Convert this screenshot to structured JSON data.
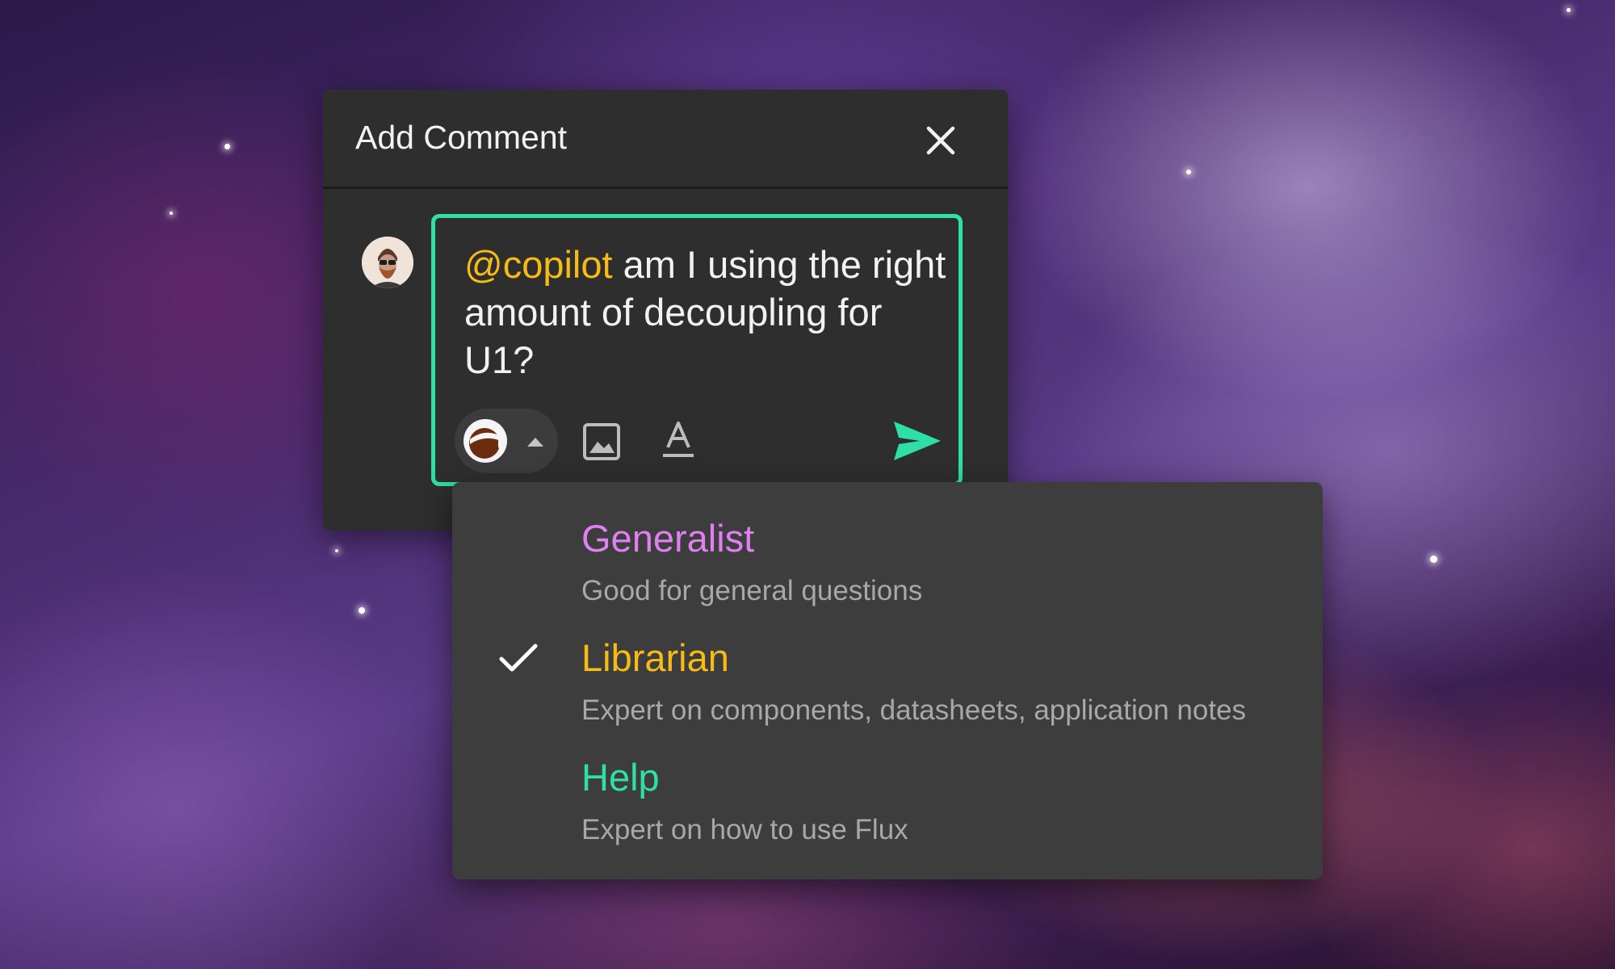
{
  "dialog": {
    "title": "Add Comment",
    "close_icon": "close-icon"
  },
  "composer": {
    "mention": "@copilot",
    "text": " am I using the right amount of decoupling for U1?",
    "border_color": "#2ee0a6",
    "mention_color": "#f7bb16",
    "toolbar": {
      "copilot_icon": "copilot-avatar-icon",
      "caret_icon": "caret-up-icon",
      "image_icon": "image-icon",
      "format_icon": "text-format-icon",
      "send_icon": "send-icon",
      "send_color": "#2ee0a6"
    }
  },
  "dropdown": {
    "options": [
      {
        "name": "Generalist",
        "description": "Good for general questions",
        "color": "#e07ff0",
        "selected": false
      },
      {
        "name": "Librarian",
        "description": "Expert on components, datasheets, application notes",
        "color": "#f7bb16",
        "selected": true
      },
      {
        "name": "Help",
        "description": "Expert on how to use Flux",
        "color": "#2ee0a6",
        "selected": false
      }
    ]
  }
}
